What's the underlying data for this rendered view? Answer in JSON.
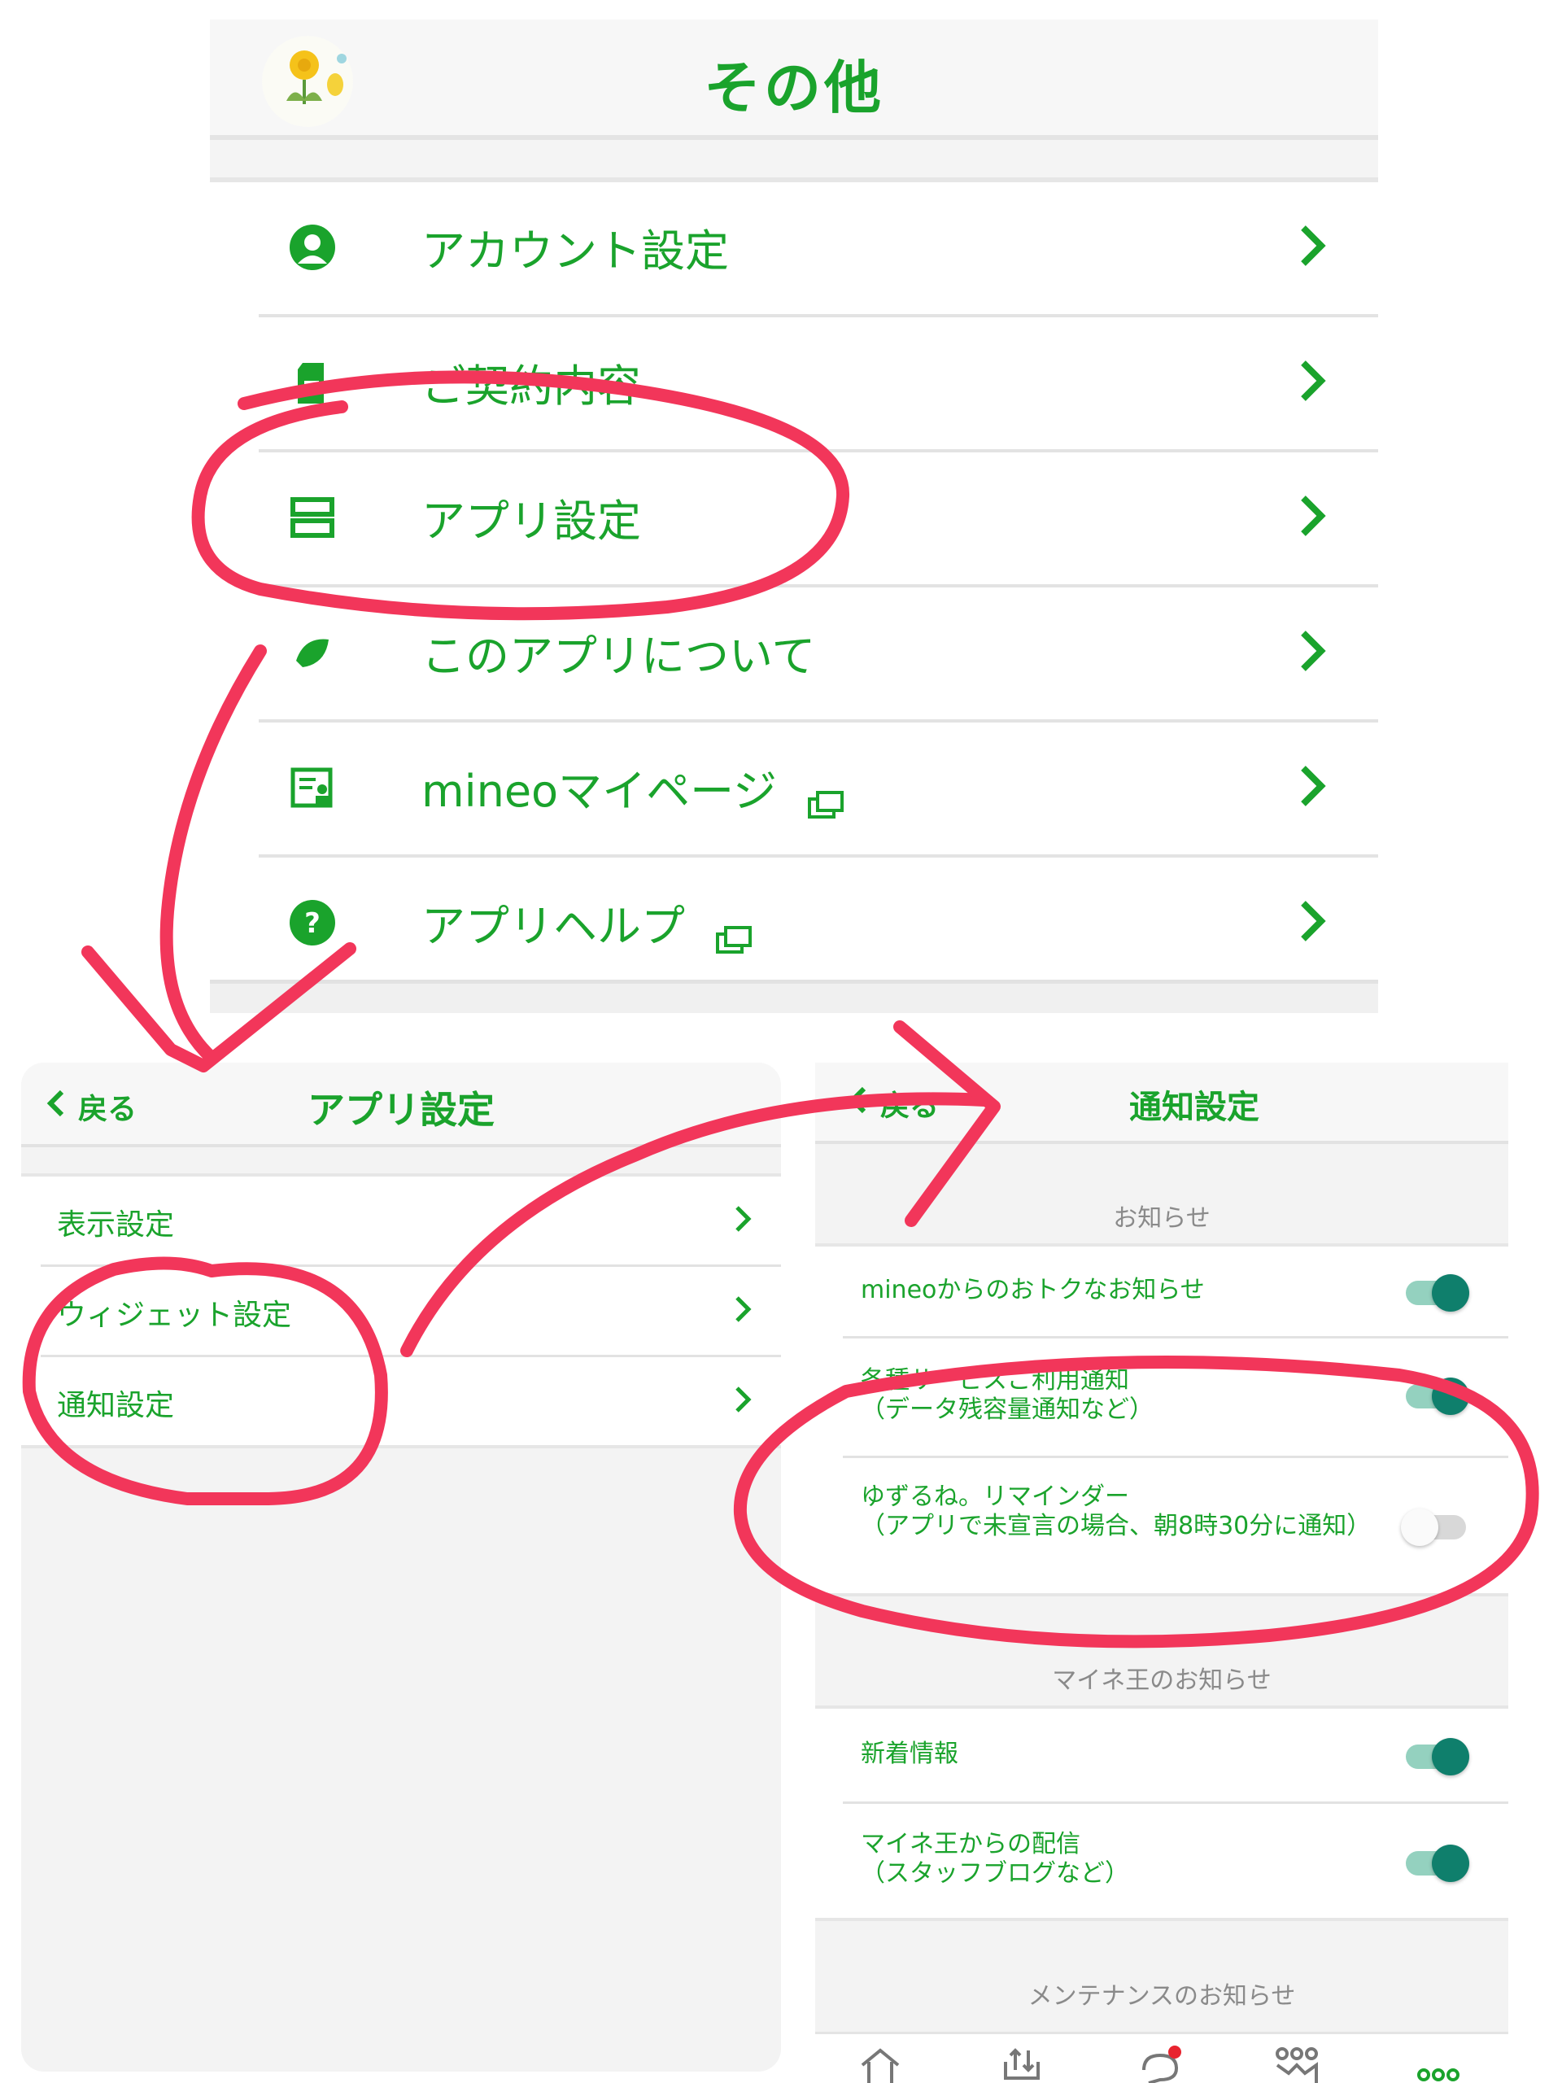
{
  "top_screen": {
    "title": "その他",
    "items": [
      {
        "label": "アカウント設定",
        "icon": "user-circle-icon"
      },
      {
        "label": "ご契約内容",
        "icon": "document-icon"
      },
      {
        "label": "アプリ設定",
        "icon": "app-settings-icon"
      },
      {
        "label": "このアプリについて",
        "icon": "leaf-icon"
      },
      {
        "label": "mineoマイページ",
        "icon": "profile-card-icon",
        "external": true
      },
      {
        "label": "アプリヘルプ",
        "icon": "help-circle-icon",
        "external": true
      }
    ]
  },
  "app_settings_screen": {
    "back_label": "戻る",
    "title": "アプリ設定",
    "items": [
      {
        "label": "表示設定"
      },
      {
        "label": "ウィジェット設定"
      },
      {
        "label": "通知設定"
      }
    ]
  },
  "notification_screen": {
    "back_label": "戻る",
    "title": "通知設定",
    "section_oshirase": "お知らせ",
    "oshirase_items": [
      {
        "label": "mineoからのおトクなお知らせ",
        "enabled": true
      },
      {
        "label": "各種サービスご利用通知\n（データ残容量通知など）",
        "enabled": true
      },
      {
        "label": "ゆずるね。リマインダー\n（アプリで未宣言の場合、朝8時30分に通知）",
        "enabled": false
      }
    ],
    "section_maineou": "マイネ王のお知らせ",
    "maineou_items": [
      {
        "label": "新着情報",
        "enabled": true
      },
      {
        "label": "マイネ王からの配信\n（スタッフブログなど）",
        "enabled": true
      }
    ],
    "section_maintenance": "メンテナンスのお知らせ",
    "nav_icons": [
      "home-icon",
      "data-transfer-icon",
      "chat-icon",
      "community-icon",
      "more-icon"
    ]
  },
  "colors": {
    "brand_green": "#1aa32c",
    "toggle_on": "#0f7f6c",
    "annotation_red": "#f2365a"
  }
}
